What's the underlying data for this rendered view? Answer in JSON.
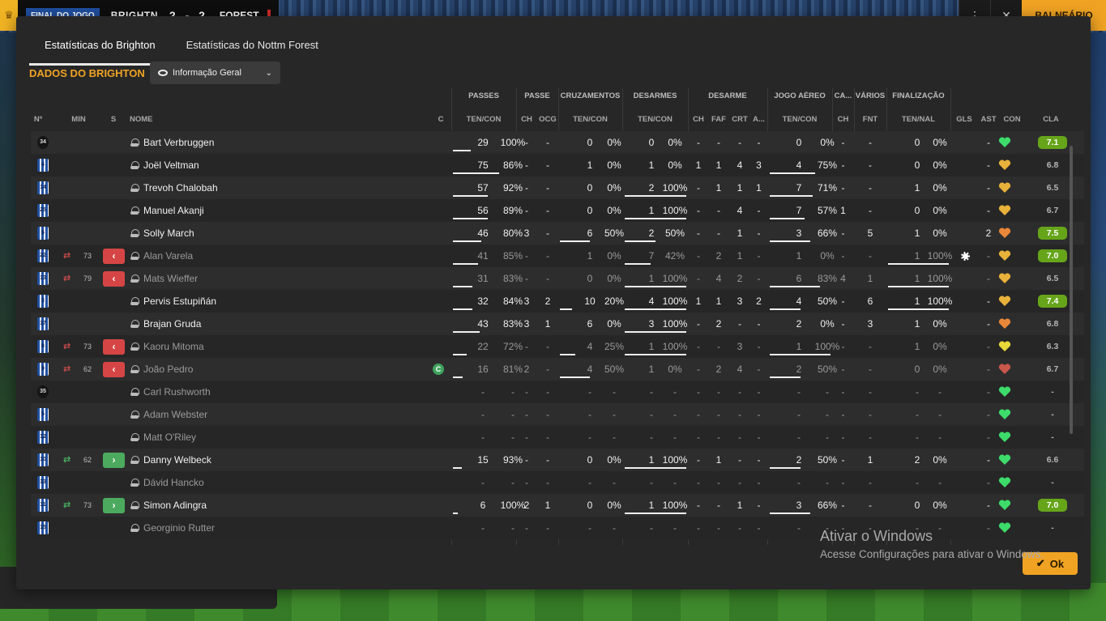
{
  "topbar": {
    "final_label": "FINAL DO JOGO",
    "home_team": "BRIGHTN",
    "score": "2 - 2",
    "away_team": "FOREST",
    "locker_room_label": "BALNEÁRIO"
  },
  "tabs": [
    "Estatísticas do Brighton",
    "Estatísticas do Nottm Forest"
  ],
  "section_title": "DADOS DO BRIGHTON",
  "view_dropdown": "Informação Geral",
  "group_headers": {
    "passes": "PASSES",
    "passe": "PASSE",
    "crosses": "CRUZAMENTOS",
    "tackles": "DESARMES",
    "desarme": "DESARME",
    "aerial": "JOGO AÉREO",
    "ca": "CA...",
    "various": "VÁRIOS",
    "finishing": "FINALIZAÇÃO"
  },
  "column_headers": {
    "no": "Nº",
    "min": "MIN",
    "s": "S",
    "name": "NOME",
    "c": "C",
    "passes": "TEN/CON",
    "p_ch": "CH",
    "p_ocg": "OCG",
    "crosses": "TEN/CON",
    "tackles": "TEN/CON",
    "d_ch": "CH",
    "d_faf": "FAF",
    "d_crt": "CRT",
    "d_a": "A...",
    "aerial": "TEN/CON",
    "ca_ch": "CH",
    "fnt": "FNT",
    "shots": "TEN/NAL",
    "gls": "GLS",
    "ast": "AST",
    "con": "CON",
    "cla": "CLA"
  },
  "rows": [
    {
      "no": "34",
      "gk": true,
      "name": "Bart Verbruggen",
      "min": "",
      "sub": "",
      "pass_att": "29",
      "pass_pct": "100%",
      "pass_fill": 0.29,
      "p_ch": "-",
      "p_ocg": "-",
      "cr_att": "0",
      "cr_pct": "0%",
      "cr_fill": 0,
      "tk_att": "0",
      "tk_pct": "0%",
      "tk_fill": 0,
      "d_ch": "-",
      "d_faf": "-",
      "d_crt": "-",
      "d_a": "-",
      "ae_att": "0",
      "ae_pct": "0%",
      "ae_fill": 0,
      "ca_ch": "-",
      "fnt": "-",
      "sh_att": "0",
      "sh_pct": "0%",
      "sh_fill": 0,
      "gls": "",
      "ast": "-",
      "con": "green",
      "cla": "7.1",
      "cla_good": true,
      "captain": false,
      "goal": false,
      "muted": false
    },
    {
      "no": "4",
      "gk": false,
      "name": "Joël Veltman",
      "min": "",
      "sub": "",
      "pass_att": "75",
      "pass_pct": "86%",
      "pass_fill": 0.75,
      "p_ch": "-",
      "p_ocg": "-",
      "cr_att": "1",
      "cr_pct": "0%",
      "cr_fill": 0,
      "tk_att": "1",
      "tk_pct": "0%",
      "tk_fill": 0,
      "d_ch": "1",
      "d_faf": "1",
      "d_crt": "4",
      "d_a": "3",
      "ae_att": "4",
      "ae_pct": "75%",
      "ae_fill": 0.75,
      "ca_ch": "-",
      "fnt": "-",
      "sh_att": "0",
      "sh_pct": "0%",
      "sh_fill": 0,
      "gls": "",
      "ast": "-",
      "con": "gold",
      "cla": "6.8",
      "cla_good": false,
      "captain": false,
      "goal": false,
      "muted": false
    },
    {
      "no": "14",
      "gk": false,
      "name": "Trevoh Chalobah",
      "min": "",
      "sub": "",
      "pass_att": "57",
      "pass_pct": "92%",
      "pass_fill": 0.57,
      "p_ch": "-",
      "p_ocg": "-",
      "cr_att": "0",
      "cr_pct": "0%",
      "cr_fill": 0,
      "tk_att": "2",
      "tk_pct": "100%",
      "tk_fill": 1,
      "d_ch": "-",
      "d_faf": "1",
      "d_crt": "1",
      "d_a": "1",
      "ae_att": "7",
      "ae_pct": "71%",
      "ae_fill": 0.71,
      "ca_ch": "-",
      "fnt": "-",
      "sh_att": "1",
      "sh_pct": "0%",
      "sh_fill": 0,
      "gls": "",
      "ast": "-",
      "con": "gold",
      "cla": "6.5",
      "cla_good": false,
      "captain": false,
      "goal": false,
      "muted": false
    },
    {
      "no": "25",
      "gk": false,
      "name": "Manuel Akanji",
      "min": "",
      "sub": "",
      "pass_att": "56",
      "pass_pct": "89%",
      "pass_fill": 0.56,
      "p_ch": "-",
      "p_ocg": "-",
      "cr_att": "0",
      "cr_pct": "0%",
      "cr_fill": 0,
      "tk_att": "1",
      "tk_pct": "100%",
      "tk_fill": 1,
      "d_ch": "-",
      "d_faf": "-",
      "d_crt": "4",
      "d_a": "-",
      "ae_att": "7",
      "ae_pct": "57%",
      "ae_fill": 0.57,
      "ca_ch": "1",
      "fnt": "-",
      "sh_att": "0",
      "sh_pct": "0%",
      "sh_fill": 0,
      "gls": "",
      "ast": "-",
      "con": "gold",
      "cla": "6.7",
      "cla_good": false,
      "captain": false,
      "goal": false,
      "muted": false
    },
    {
      "no": "6",
      "gk": false,
      "name": "Solly March",
      "min": "",
      "sub": "",
      "pass_att": "46",
      "pass_pct": "80%",
      "pass_fill": 0.46,
      "p_ch": "3",
      "p_ocg": "-",
      "cr_att": "6",
      "cr_pct": "50%",
      "cr_fill": 0.5,
      "tk_att": "2",
      "tk_pct": "50%",
      "tk_fill": 0.5,
      "d_ch": "-",
      "d_faf": "-",
      "d_crt": "1",
      "d_a": "-",
      "ae_att": "3",
      "ae_pct": "66%",
      "ae_fill": 0.66,
      "ca_ch": "-",
      "fnt": "5",
      "sh_att": "1",
      "sh_pct": "0%",
      "sh_fill": 0,
      "gls": "",
      "ast": "2",
      "con": "orange",
      "cla": "7.5",
      "cla_good": true,
      "captain": false,
      "goal": false,
      "muted": false
    },
    {
      "no": "22",
      "gk": false,
      "name": "Alan Varela",
      "min": "73",
      "sub": "out",
      "pass_att": "41",
      "pass_pct": "85%",
      "pass_fill": 0.41,
      "p_ch": "-",
      "p_ocg": "-",
      "cr_att": "1",
      "cr_pct": "0%",
      "cr_fill": 0,
      "tk_att": "7",
      "tk_pct": "42%",
      "tk_fill": 0.42,
      "d_ch": "-",
      "d_faf": "2",
      "d_crt": "1",
      "d_a": "-",
      "ae_att": "1",
      "ae_pct": "0%",
      "ae_fill": 0,
      "ca_ch": "-",
      "fnt": "-",
      "sh_att": "1",
      "sh_pct": "100%",
      "sh_fill": 1,
      "gls": "",
      "ast": "-",
      "con": "gold",
      "cla": "7.0",
      "cla_good": true,
      "captain": false,
      "goal": true,
      "muted": true
    },
    {
      "no": "13",
      "gk": false,
      "name": "Mats Wieffer",
      "min": "79",
      "sub": "out",
      "pass_att": "31",
      "pass_pct": "83%",
      "pass_fill": 0.31,
      "p_ch": "-",
      "p_ocg": "-",
      "cr_att": "0",
      "cr_pct": "0%",
      "cr_fill": 0,
      "tk_att": "1",
      "tk_pct": "100%",
      "tk_fill": 1,
      "d_ch": "-",
      "d_faf": "4",
      "d_crt": "2",
      "d_a": "-",
      "ae_att": "6",
      "ae_pct": "83%",
      "ae_fill": 0.83,
      "ca_ch": "4",
      "fnt": "1",
      "sh_att": "1",
      "sh_pct": "100%",
      "sh_fill": 1,
      "gls": "",
      "ast": "-",
      "con": "gold",
      "cla": "6.5",
      "cla_good": false,
      "captain": false,
      "goal": false,
      "muted": true
    },
    {
      "no": "3",
      "gk": false,
      "name": "Pervis Estupiñán",
      "min": "",
      "sub": "",
      "pass_att": "32",
      "pass_pct": "84%",
      "pass_fill": 0.32,
      "p_ch": "3",
      "p_ocg": "2",
      "cr_att": "10",
      "cr_pct": "20%",
      "cr_fill": 0.2,
      "tk_att": "4",
      "tk_pct": "100%",
      "tk_fill": 1,
      "d_ch": "1",
      "d_faf": "1",
      "d_crt": "3",
      "d_a": "2",
      "ae_att": "4",
      "ae_pct": "50%",
      "ae_fill": 0.5,
      "ca_ch": "-",
      "fnt": "6",
      "sh_att": "1",
      "sh_pct": "100%",
      "sh_fill": 1,
      "gls": "",
      "ast": "-",
      "con": "gold",
      "cla": "7.4",
      "cla_good": true,
      "captain": false,
      "goal": false,
      "muted": false
    },
    {
      "no": "37",
      "gk": false,
      "name": "Brajan Gruda",
      "min": "",
      "sub": "",
      "pass_att": "43",
      "pass_pct": "83%",
      "pass_fill": 0.43,
      "p_ch": "3",
      "p_ocg": "1",
      "cr_att": "6",
      "cr_pct": "0%",
      "cr_fill": 0,
      "tk_att": "3",
      "tk_pct": "100%",
      "tk_fill": 1,
      "d_ch": "-",
      "d_faf": "2",
      "d_crt": "-",
      "d_a": "-",
      "ae_att": "2",
      "ae_pct": "0%",
      "ae_fill": 0,
      "ca_ch": "-",
      "fnt": "3",
      "sh_att": "1",
      "sh_pct": "0%",
      "sh_fill": 0,
      "gls": "",
      "ast": "-",
      "con": "orange",
      "cla": "6.8",
      "cla_good": false,
      "captain": false,
      "goal": false,
      "muted": false
    },
    {
      "no": "8",
      "gk": false,
      "name": "Kaoru Mitoma",
      "min": "73",
      "sub": "out",
      "pass_att": "22",
      "pass_pct": "72%",
      "pass_fill": 0.22,
      "p_ch": "-",
      "p_ocg": "-",
      "cr_att": "4",
      "cr_pct": "25%",
      "cr_fill": 0.25,
      "tk_att": "1",
      "tk_pct": "100%",
      "tk_fill": 1,
      "d_ch": "-",
      "d_faf": "-",
      "d_crt": "3",
      "d_a": "-",
      "ae_att": "1",
      "ae_pct": "100%",
      "ae_fill": 1,
      "ca_ch": "-",
      "fnt": "-",
      "sh_att": "1",
      "sh_pct": "0%",
      "sh_fill": 0,
      "gls": "",
      "ast": "-",
      "con": "yellow",
      "cla": "6.3",
      "cla_good": false,
      "captain": false,
      "goal": false,
      "muted": true
    },
    {
      "no": "9",
      "gk": false,
      "name": "João Pedro",
      "min": "62",
      "sub": "out",
      "pass_att": "16",
      "pass_pct": "81%",
      "pass_fill": 0.16,
      "p_ch": "2",
      "p_ocg": "-",
      "cr_att": "4",
      "cr_pct": "50%",
      "cr_fill": 0.5,
      "tk_att": "1",
      "tk_pct": "0%",
      "tk_fill": 0,
      "d_ch": "-",
      "d_faf": "2",
      "d_crt": "4",
      "d_a": "-",
      "ae_att": "2",
      "ae_pct": "50%",
      "ae_fill": 0.5,
      "ca_ch": "-",
      "fnt": "-",
      "sh_att": "0",
      "sh_pct": "0%",
      "sh_fill": 0,
      "gls": "",
      "ast": "-",
      "con": "red",
      "cla": "6.7",
      "cla_good": false,
      "captain": true,
      "goal": false,
      "muted": true
    },
    {
      "no": "35",
      "gk": true,
      "name": "Carl Rushworth",
      "min": "",
      "sub": "",
      "pass_att": "-",
      "pass_pct": "-",
      "pass_fill": 0,
      "p_ch": "-",
      "p_ocg": "-",
      "cr_att": "-",
      "cr_pct": "-",
      "cr_fill": 0,
      "tk_att": "-",
      "tk_pct": "-",
      "tk_fill": 0,
      "d_ch": "-",
      "d_faf": "-",
      "d_crt": "-",
      "d_a": "-",
      "ae_att": "-",
      "ae_pct": "-",
      "ae_fill": 0,
      "ca_ch": "-",
      "fnt": "-",
      "sh_att": "-",
      "sh_pct": "-",
      "sh_fill": 0,
      "gls": "",
      "ast": "-",
      "con": "green",
      "cla": "-",
      "cla_good": false,
      "captain": false,
      "goal": false,
      "muted": true
    },
    {
      "no": "5",
      "gk": false,
      "name": "Adam Webster",
      "min": "",
      "sub": "",
      "pass_att": "-",
      "pass_pct": "-",
      "pass_fill": 0,
      "p_ch": "-",
      "p_ocg": "-",
      "cr_att": "-",
      "cr_pct": "-",
      "cr_fill": 0,
      "tk_att": "-",
      "tk_pct": "-",
      "tk_fill": 0,
      "d_ch": "-",
      "d_faf": "-",
      "d_crt": "-",
      "d_a": "-",
      "ae_att": "-",
      "ae_pct": "-",
      "ae_fill": 0,
      "ca_ch": "-",
      "fnt": "-",
      "sh_att": "-",
      "sh_pct": "-",
      "sh_fill": 0,
      "gls": "",
      "ast": "-",
      "con": "green",
      "cla": "-",
      "cla_good": false,
      "captain": false,
      "goal": false,
      "muted": true
    },
    {
      "no": "12",
      "gk": false,
      "name": "Matt O'Riley",
      "min": "",
      "sub": "",
      "pass_att": "-",
      "pass_pct": "-",
      "pass_fill": 0,
      "p_ch": "-",
      "p_ocg": "-",
      "cr_att": "-",
      "cr_pct": "-",
      "cr_fill": 0,
      "tk_att": "-",
      "tk_pct": "-",
      "tk_fill": 0,
      "d_ch": "-",
      "d_faf": "-",
      "d_crt": "-",
      "d_a": "-",
      "ae_att": "-",
      "ae_pct": "-",
      "ae_fill": 0,
      "ca_ch": "-",
      "fnt": "-",
      "sh_att": "-",
      "sh_pct": "-",
      "sh_fill": 0,
      "gls": "",
      "ast": "-",
      "con": "green",
      "cla": "-",
      "cla_good": false,
      "captain": false,
      "goal": false,
      "muted": true
    },
    {
      "no": "10",
      "gk": false,
      "name": "Danny Welbeck",
      "min": "62",
      "sub": "in",
      "pass_att": "15",
      "pass_pct": "93%",
      "pass_fill": 0.15,
      "p_ch": "-",
      "p_ocg": "-",
      "cr_att": "0",
      "cr_pct": "0%",
      "cr_fill": 0,
      "tk_att": "1",
      "tk_pct": "100%",
      "tk_fill": 1,
      "d_ch": "-",
      "d_faf": "1",
      "d_crt": "-",
      "d_a": "-",
      "ae_att": "2",
      "ae_pct": "50%",
      "ae_fill": 0.5,
      "ca_ch": "-",
      "fnt": "1",
      "sh_att": "2",
      "sh_pct": "0%",
      "sh_fill": 0,
      "gls": "",
      "ast": "-",
      "con": "green",
      "cla": "6.6",
      "cla_good": false,
      "captain": false,
      "goal": false,
      "muted": false
    },
    {
      "no": "33",
      "gk": false,
      "name": "Dávid Hancko",
      "min": "",
      "sub": "",
      "pass_att": "-",
      "pass_pct": "-",
      "pass_fill": 0,
      "p_ch": "-",
      "p_ocg": "-",
      "cr_att": "-",
      "cr_pct": "-",
      "cr_fill": 0,
      "tk_att": "-",
      "tk_pct": "-",
      "tk_fill": 0,
      "d_ch": "-",
      "d_faf": "-",
      "d_crt": "-",
      "d_a": "-",
      "ae_att": "-",
      "ae_pct": "-",
      "ae_fill": 0,
      "ca_ch": "-",
      "fnt": "-",
      "sh_att": "-",
      "sh_pct": "-",
      "sh_fill": 0,
      "gls": "",
      "ast": "-",
      "con": "green",
      "cla": "-",
      "cla_good": false,
      "captain": false,
      "goal": false,
      "muted": true
    },
    {
      "no": "11",
      "gk": false,
      "name": "Simon Adingra",
      "min": "73",
      "sub": "in",
      "pass_att": "6",
      "pass_pct": "100%",
      "pass_fill": 0.06,
      "p_ch": "2",
      "p_ocg": "1",
      "cr_att": "0",
      "cr_pct": "0%",
      "cr_fill": 0,
      "tk_att": "1",
      "tk_pct": "100%",
      "tk_fill": 1,
      "d_ch": "-",
      "d_faf": "-",
      "d_crt": "1",
      "d_a": "-",
      "ae_att": "3",
      "ae_pct": "66%",
      "ae_fill": 0.66,
      "ca_ch": "-",
      "fnt": "-",
      "sh_att": "0",
      "sh_pct": "0%",
      "sh_fill": 0,
      "gls": "",
      "ast": "-",
      "con": "green",
      "cla": "7.0",
      "cla_good": true,
      "captain": false,
      "goal": false,
      "muted": false
    },
    {
      "no": "15",
      "gk": false,
      "name": "Georginio Rutter",
      "min": "",
      "sub": "",
      "pass_att": "-",
      "pass_pct": "-",
      "pass_fill": 0,
      "p_ch": "-",
      "p_ocg": "-",
      "cr_att": "-",
      "cr_pct": "-",
      "cr_fill": 0,
      "tk_att": "-",
      "tk_pct": "-",
      "tk_fill": 0,
      "d_ch": "-",
      "d_faf": "-",
      "d_crt": "-",
      "d_a": "-",
      "ae_att": "-",
      "ae_pct": "-",
      "ae_fill": 0,
      "ca_ch": "-",
      "fnt": "-",
      "sh_att": "-",
      "sh_pct": "-",
      "sh_fill": 0,
      "gls": "",
      "ast": "-",
      "con": "green",
      "cla": "-",
      "cla_good": false,
      "captain": false,
      "goal": false,
      "muted": true
    }
  ],
  "heart_colors": {
    "green": "#3ddc6a",
    "gold": "#e8b13a",
    "orange": "#e8873a",
    "yellow": "#e8d83a",
    "red": "#c9574a"
  },
  "watermark": {
    "title": "Ativar o Windows",
    "subtitle": "Acesse Configurações para ativar o Windows."
  },
  "ok_label": "Ok"
}
